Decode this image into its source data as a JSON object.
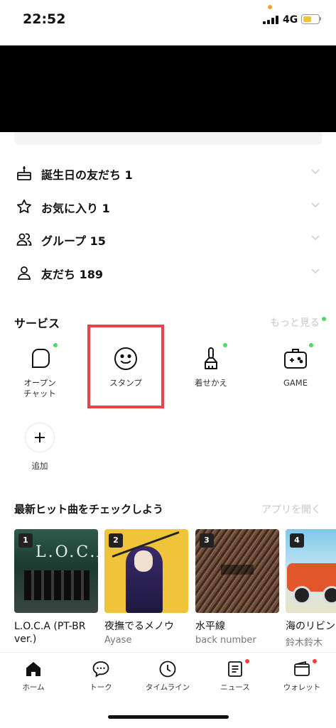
{
  "status": {
    "time": "22:52",
    "network": "4G",
    "battery_level": 0.55,
    "battery_color": "#f6c52e"
  },
  "friends_list": [
    {
      "label": "誕生日の友だち 1",
      "icon": "cake-icon"
    },
    {
      "label": "お気に入り 1",
      "icon": "star-icon"
    },
    {
      "label": "グループ 15",
      "icon": "group-icon"
    },
    {
      "label": "友だち 189",
      "icon": "person-icon"
    }
  ],
  "services": {
    "title": "サービス",
    "more": "もっと見る",
    "items": [
      {
        "label": "オープン\nチャット",
        "icon": "open-chat-icon",
        "badge": true
      },
      {
        "label": "スタンプ",
        "icon": "smiley-icon",
        "badge": false,
        "highlighted": true
      },
      {
        "label": "着せかえ",
        "icon": "brush-icon",
        "badge": true
      },
      {
        "label": "GAME",
        "icon": "game-controller-icon",
        "badge": true
      }
    ],
    "add_label": "追加"
  },
  "music": {
    "title": "最新ヒット曲をチェックしよう",
    "open_app": "アプリを開く",
    "albums": [
      {
        "rank": "1",
        "song": "L.O.C.A (PT-BR",
        "song_line2": "ver.)",
        "artist": ""
      },
      {
        "rank": "2",
        "song": "夜撫でるメノウ",
        "artist": "Ayase"
      },
      {
        "rank": "3",
        "song": "水平線",
        "artist": "back number"
      },
      {
        "rank": "4",
        "song": "海のリビン",
        "artist": "鈴木鈴木"
      }
    ]
  },
  "tabs": [
    {
      "label": "ホーム",
      "icon": "home-icon",
      "active": true,
      "badge": false
    },
    {
      "label": "トーク",
      "icon": "chat-bubble-icon",
      "badge": false
    },
    {
      "label": "タイムライン",
      "icon": "clock-icon",
      "badge": false
    },
    {
      "label": "ニュース",
      "icon": "news-icon",
      "badge": true
    },
    {
      "label": "ウォレット",
      "icon": "wallet-icon",
      "badge": true
    }
  ],
  "colors": {
    "accent_green": "#4cd964",
    "badge_red": "#ff3b30",
    "highlight": "#e8434a"
  }
}
